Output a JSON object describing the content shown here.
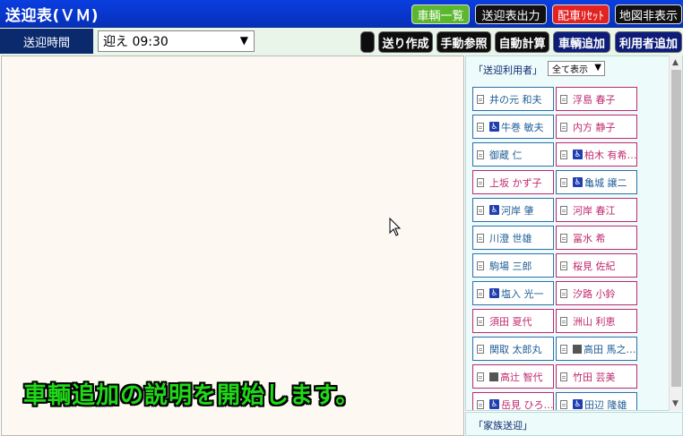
{
  "app": {
    "title": "送迎表(ＶＭ)"
  },
  "header_buttons": {
    "vehicle_list": "車輌一覧",
    "print_schedule": "送迎表出力",
    "reset_dispatch": "配車ﾘｾｯﾄ",
    "hide_map": "地図非表示"
  },
  "toolbar": {
    "time_label": "送迎時間",
    "time_value": "迎え 09:30",
    "send_create": "送り作成",
    "manual_ref": "手動参照",
    "auto_calc": "自動計算",
    "add_vehicle": "車輌追加",
    "add_user": "利用者追加"
  },
  "panel": {
    "title": "「送迎利用者」",
    "filter_value": "全て表示",
    "users": [
      {
        "name": "井の元 和夫",
        "color": "blue",
        "wheelchair": false,
        "photo": false
      },
      {
        "name": "浮島 春子",
        "color": "pink",
        "wheelchair": false,
        "photo": false
      },
      {
        "name": "牛巻 敏夫",
        "color": "blue",
        "wheelchair": true,
        "photo": false
      },
      {
        "name": "内方 静子",
        "color": "pink",
        "wheelchair": false,
        "photo": false
      },
      {
        "name": "御蔵 仁",
        "color": "blue",
        "wheelchair": false,
        "photo": false
      },
      {
        "name": "柏木 有希…",
        "color": "pink",
        "wheelchair": true,
        "photo": false
      },
      {
        "name": "上坂 かず子",
        "color": "pink",
        "wheelchair": false,
        "photo": false
      },
      {
        "name": "亀城 譲二",
        "color": "blue",
        "wheelchair": true,
        "photo": false
      },
      {
        "name": "河岸 肇",
        "color": "blue",
        "wheelchair": true,
        "photo": false
      },
      {
        "name": "河岸 春江",
        "color": "pink",
        "wheelchair": false,
        "photo": false
      },
      {
        "name": "川澄 世雄",
        "color": "blue",
        "wheelchair": false,
        "photo": false
      },
      {
        "name": "冨水 希",
        "color": "pink",
        "wheelchair": false,
        "photo": false
      },
      {
        "name": "駒場 三郎",
        "color": "blue",
        "wheelchair": false,
        "photo": false
      },
      {
        "name": "桜見 佐紀",
        "color": "pink",
        "wheelchair": false,
        "photo": false
      },
      {
        "name": "塩入 光一",
        "color": "blue",
        "wheelchair": true,
        "photo": false
      },
      {
        "name": "汐路 小鈴",
        "color": "pink",
        "wheelchair": false,
        "photo": false
      },
      {
        "name": "須田 夏代",
        "color": "pink",
        "wheelchair": false,
        "photo": false
      },
      {
        "name": "洲山 利恵",
        "color": "pink",
        "wheelchair": false,
        "photo": false
      },
      {
        "name": "関取 太郎丸",
        "color": "blue",
        "wheelchair": false,
        "photo": false
      },
      {
        "name": "高田 馬之…",
        "color": "blue",
        "wheelchair": false,
        "photo": true
      },
      {
        "name": "高辻 智代",
        "color": "pink",
        "wheelchair": false,
        "photo": true
      },
      {
        "name": "竹田 芸美",
        "color": "pink",
        "wheelchair": false,
        "photo": false
      },
      {
        "name": "岳見 ひろ…",
        "color": "pink",
        "wheelchair": true,
        "photo": false
      },
      {
        "name": "田辺 隆雄",
        "color": "blue",
        "wheelchair": true,
        "photo": false
      }
    ]
  },
  "family_section": {
    "title": "「家族送迎」"
  },
  "caption": {
    "text": "車輌追加の説明を開始します。"
  },
  "colors": {
    "title_bar": "#0a3ee0",
    "caption_text": "#20d818",
    "male": "#1f5d96",
    "female": "#c0286e",
    "navy": "#0b2a6e"
  }
}
